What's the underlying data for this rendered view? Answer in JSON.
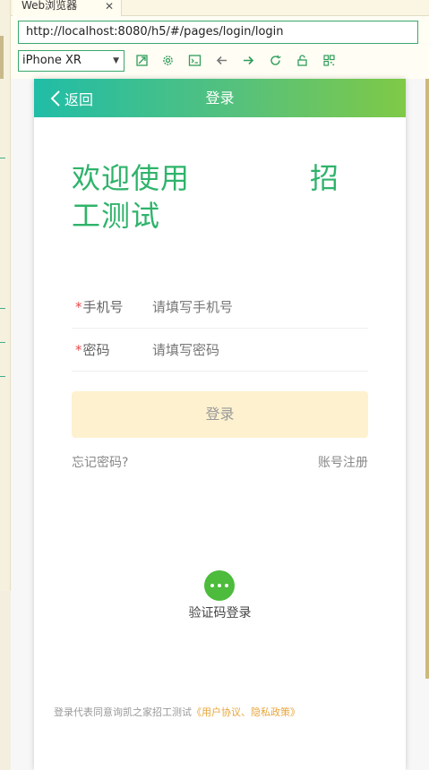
{
  "browser": {
    "tab_label": "Web浏览器",
    "url": "http://localhost:8080/h5/#/pages/login/login",
    "device": "iPhone XR"
  },
  "navbar": {
    "back_label": "返回",
    "title": "登录"
  },
  "welcome": {
    "line1_start": "欢迎使用",
    "line1_end": "招",
    "line2": "工测试"
  },
  "form": {
    "phone": {
      "required_mark": "*",
      "label": "手机号",
      "placeholder": "请填写手机号"
    },
    "password": {
      "required_mark": "*",
      "label": "密码",
      "placeholder": "请填写密码"
    }
  },
  "login_button": "登录",
  "forgot_password": "忘记密码?",
  "register": "账号注册",
  "sms_login": "验证码登录",
  "agreement": {
    "prefix": "登录代表同意询凯之家招工测试",
    "link": "《用户协议、隐私政策》"
  },
  "colors": {
    "primary_green": "#2fb36b",
    "gradient_start": "#20bda7",
    "gradient_end": "#7fc946",
    "button_bg": "#fdf1cf",
    "link_orange": "#e9a63b",
    "required_red": "#e84a4a"
  }
}
